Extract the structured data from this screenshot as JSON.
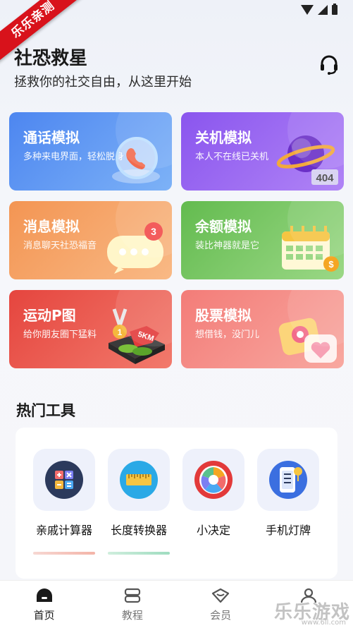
{
  "watermark": {
    "ribbon": "乐乐亲测",
    "site": "乐乐游戏",
    "url": "www.6ll.com"
  },
  "header": {
    "title": "社恐救星",
    "subtitle": "拯救你的社交自由，从这里开始",
    "support_icon": "headset-icon"
  },
  "features": [
    {
      "title": "通话模拟",
      "desc": "多种来电界面，轻松脱身",
      "color": "#4d86f0",
      "icon": "phone-icon"
    },
    {
      "title": "关机模拟",
      "desc": "本人不在线已关机",
      "color": "#8a55ee",
      "icon": "planet-404-icon",
      "badge": "404"
    },
    {
      "title": "消息模拟",
      "desc": "消息聊天社恐福音",
      "color": "#f39553",
      "icon": "chat-bubble-icon",
      "badge": "3"
    },
    {
      "title": "余额模拟",
      "desc": "装比神器就是它",
      "color": "#63bb4f",
      "icon": "calendar-coin-icon"
    },
    {
      "title": "运动P图",
      "desc": "给你朋友圈下猛料",
      "color": "#e5453e",
      "icon": "medal-shoes-icon",
      "badge": "5KM"
    },
    {
      "title": "股票模拟",
      "desc": "想借钱，没门儿",
      "color": "#f37c78",
      "icon": "heart-eye-icon"
    }
  ],
  "tools_section": {
    "title": "热门工具",
    "items": [
      {
        "label": "亲戚计算器",
        "icon": "calculator-icon"
      },
      {
        "label": "长度转换器",
        "icon": "ruler-icon"
      },
      {
        "label": "小决定",
        "icon": "wheel-icon"
      },
      {
        "label": "手机灯牌",
        "icon": "phone-lightboard-icon"
      }
    ]
  },
  "nav": [
    {
      "label": "首页",
      "icon": "home-icon",
      "active": true
    },
    {
      "label": "教程",
      "icon": "tutorial-icon",
      "active": false
    },
    {
      "label": "会员",
      "icon": "member-icon",
      "active": false
    },
    {
      "label": "",
      "icon": "profile-icon",
      "active": false
    }
  ]
}
